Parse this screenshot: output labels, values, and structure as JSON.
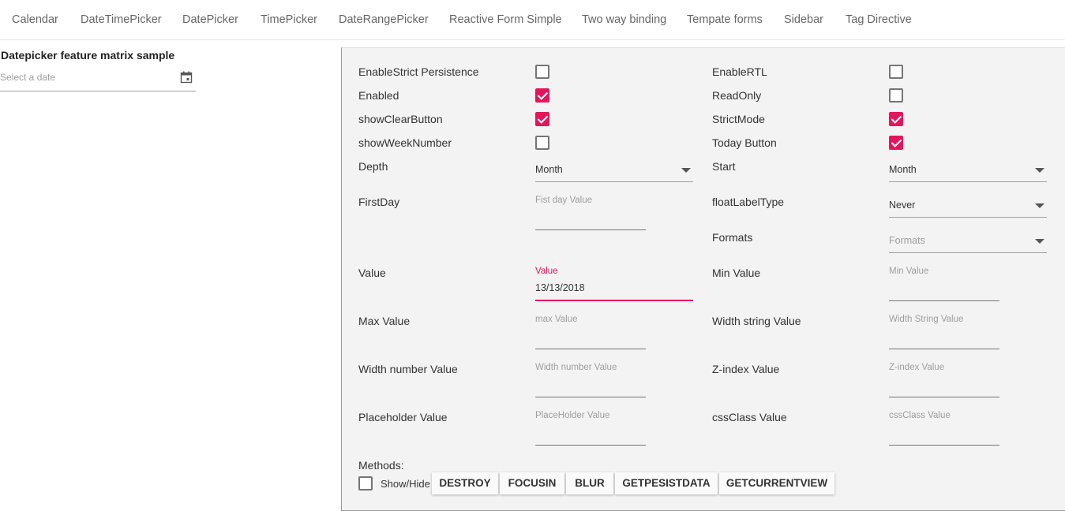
{
  "nav": {
    "items": [
      "Calendar",
      "DateTimePicker",
      "DatePicker",
      "TimePicker",
      "DateRangePicker",
      "Reactive Form Simple",
      "Two way binding",
      "Tempate forms",
      "Sidebar",
      "Tag Directive"
    ]
  },
  "sample": {
    "title": "Datepicker feature matrix sample",
    "placeholder": "Select a date"
  },
  "options": {
    "enable_strict_persistence": {
      "label": "EnableStrict Persistence",
      "checked": false
    },
    "enable_rtl": {
      "label": "EnableRTL",
      "checked": false
    },
    "enabled": {
      "label": "Enabled",
      "checked": true
    },
    "read_only": {
      "label": "ReadOnly",
      "checked": false
    },
    "show_clear_button": {
      "label": "showClearButton",
      "checked": true
    },
    "strict_mode": {
      "label": "StrictMode",
      "checked": true
    },
    "show_week_number": {
      "label": "showWeekNumber",
      "checked": false
    },
    "today_button": {
      "label": "Today Button",
      "checked": true
    }
  },
  "fields": {
    "depth": {
      "label": "Depth",
      "value": "Month"
    },
    "start": {
      "label": "Start",
      "value": "Month"
    },
    "first_day": {
      "label": "FirstDay",
      "placeholder": "Fist day Value"
    },
    "float_label_type": {
      "label": "floatLabelType",
      "value": "Never"
    },
    "formats": {
      "label": "Formats",
      "placeholder": "Formats"
    },
    "value": {
      "label": "Value",
      "float_label": "Value",
      "value": "13/13/2018"
    },
    "min_value": {
      "label": "Min Value",
      "placeholder": "Min Value"
    },
    "max_value": {
      "label": "Max Value",
      "placeholder": "max Value"
    },
    "width_string": {
      "label": "Width string Value",
      "placeholder": "Width String Value"
    },
    "width_number": {
      "label": "Width number Value",
      "placeholder": "Width number Value"
    },
    "z_index": {
      "label": "Z-index Value",
      "placeholder": "Z-index Value"
    },
    "placeholder_value": {
      "label": "Placeholder Value",
      "placeholder": "PlaceHolder Value"
    },
    "css_class": {
      "label": "cssClass Value",
      "placeholder": "cssClass Value"
    }
  },
  "methods": {
    "label": "Methods:",
    "show_hide": {
      "label": "Show/Hide",
      "checked": false
    },
    "buttons": [
      "DESTROY",
      "FOCUSIN",
      "BLUR",
      "GETPESISTDATA",
      "GETCURRENTVIEW"
    ]
  },
  "colors": {
    "accent": "#e3165b",
    "panel_bg": "#f3f3f3"
  }
}
